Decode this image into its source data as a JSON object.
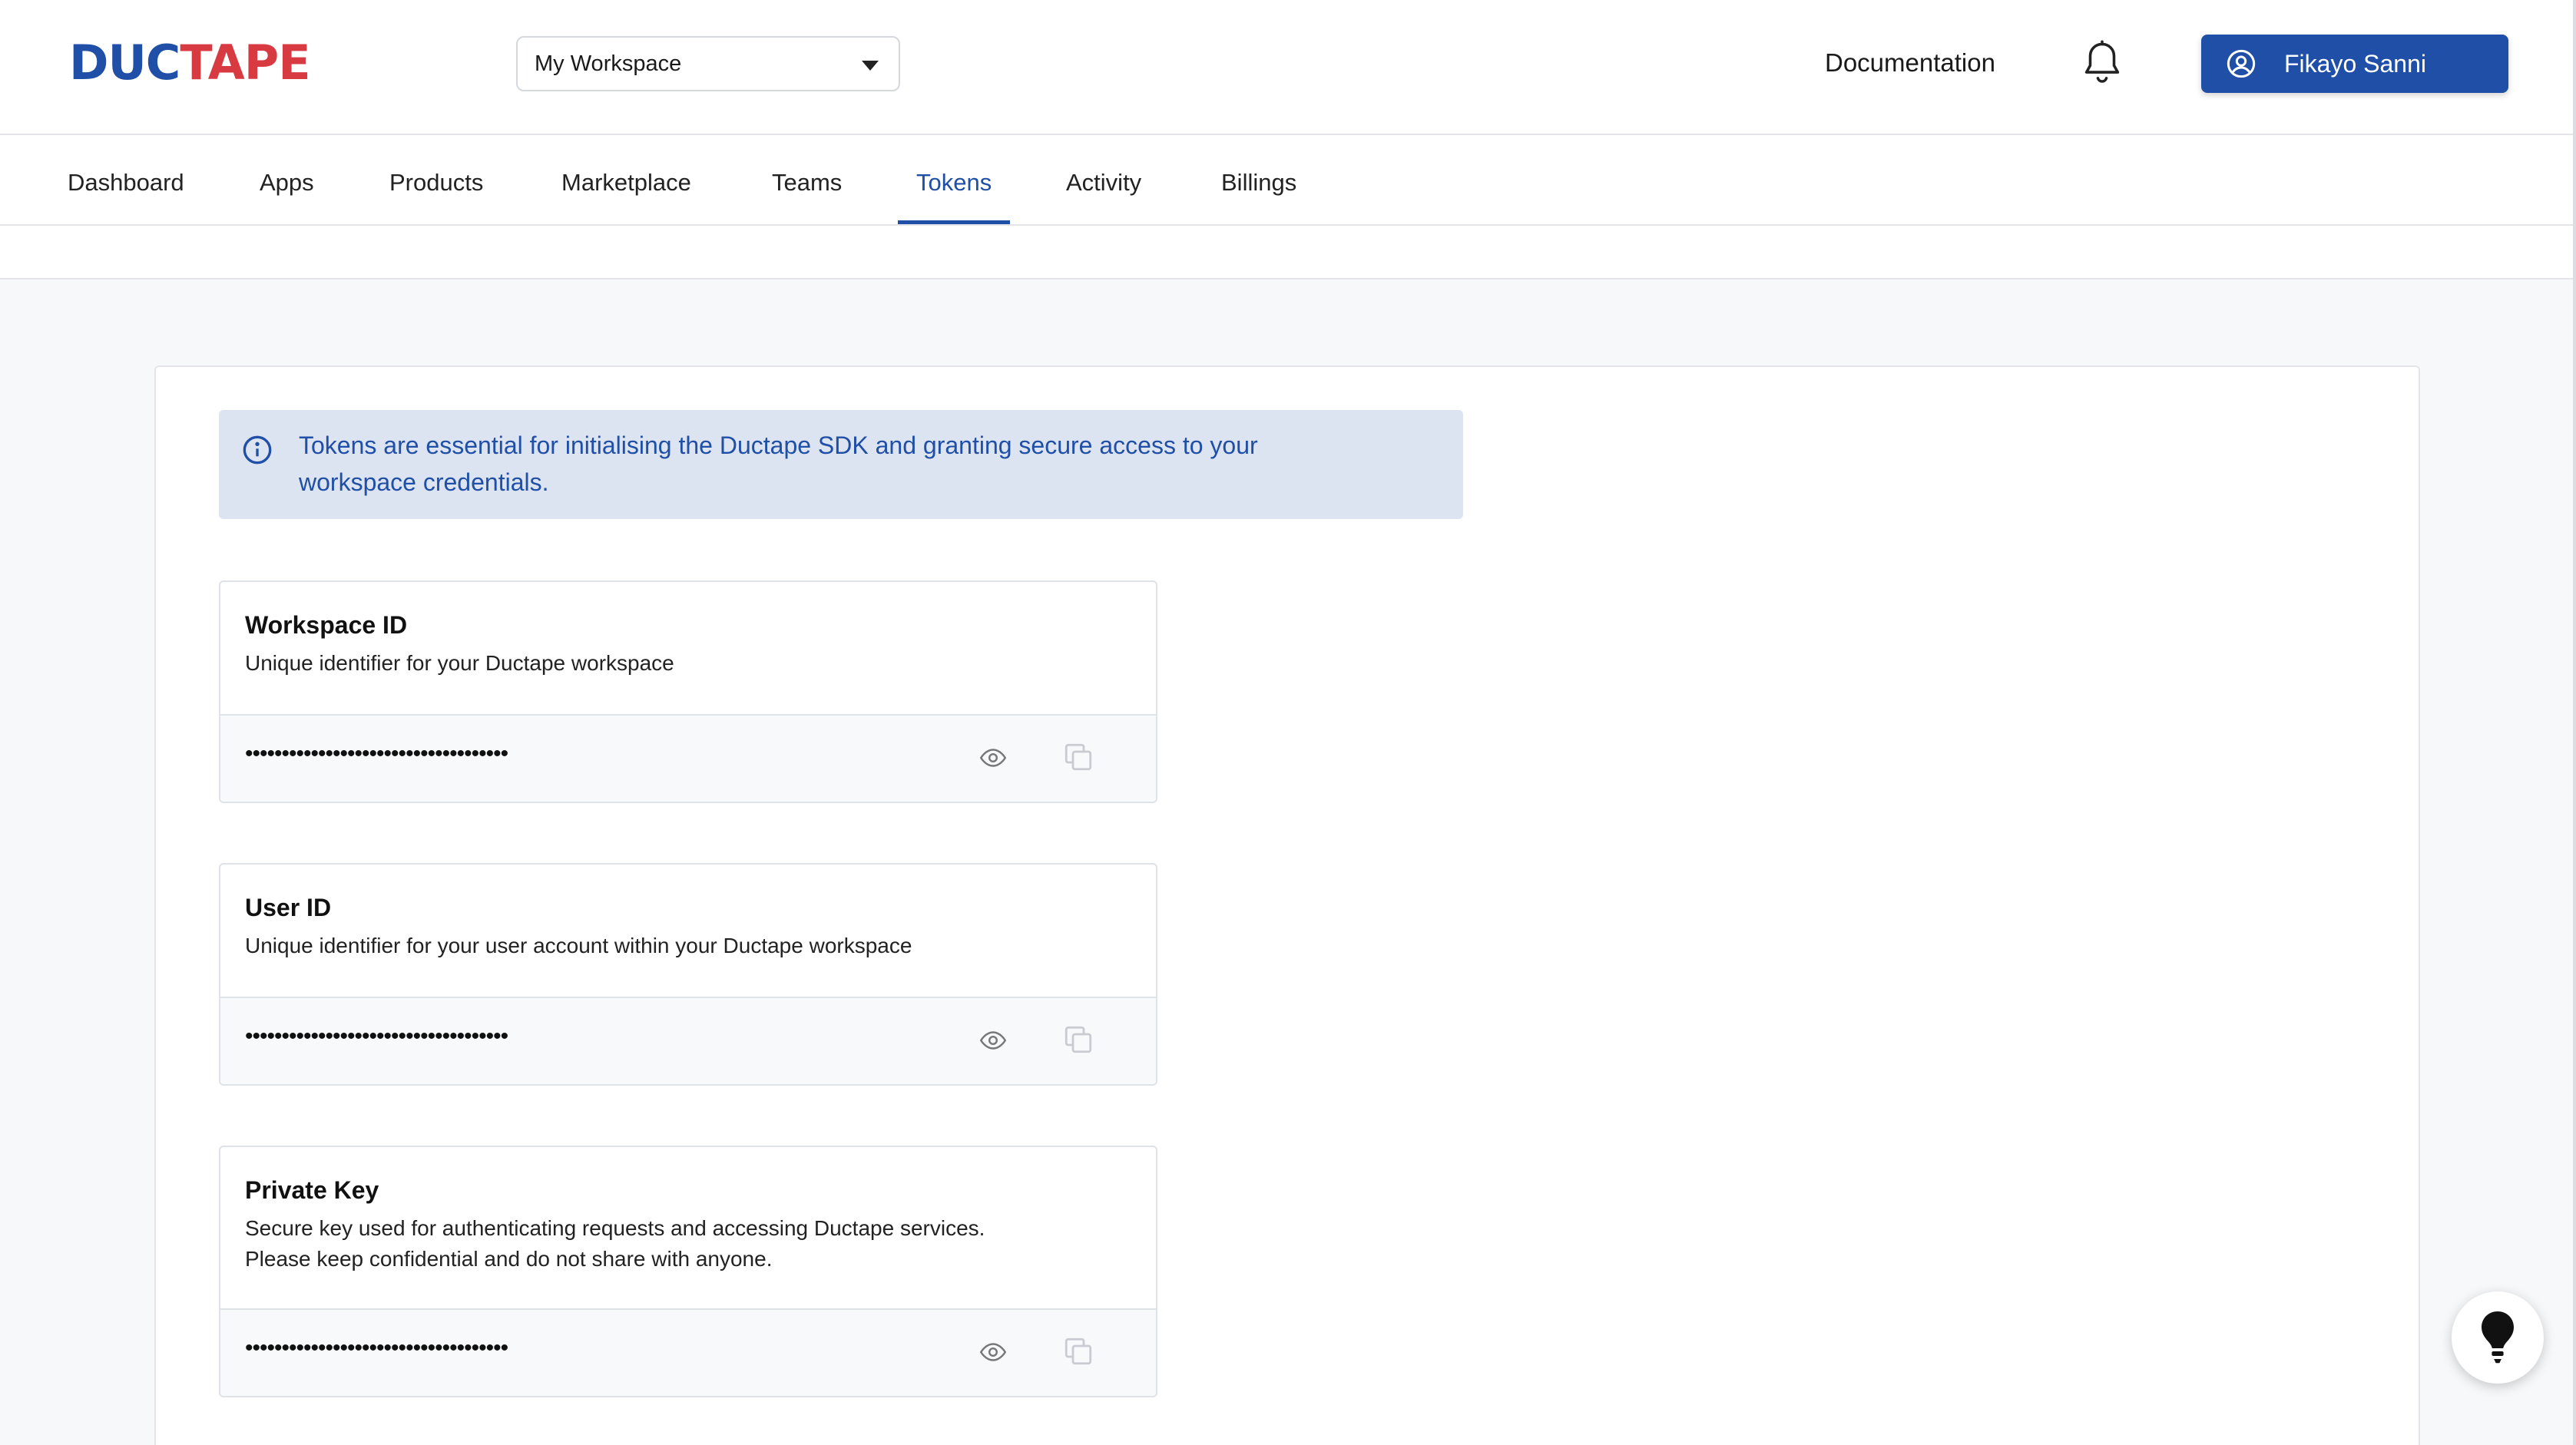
{
  "brand": {
    "part1": "DUC",
    "part2": "TAPE",
    "color1": "#1f4fa6",
    "color2": "#d83a42"
  },
  "workspace_select": {
    "value": "My Workspace"
  },
  "header": {
    "documentation": "Documentation",
    "notification_icon": "bell-icon",
    "user": {
      "name": "Fikayo Sanni",
      "icon": "user-circle-icon"
    }
  },
  "nav": {
    "items": [
      {
        "label": "Dashboard"
      },
      {
        "label": "Apps"
      },
      {
        "label": "Products"
      },
      {
        "label": "Marketplace"
      },
      {
        "label": "Teams"
      },
      {
        "label": "Tokens",
        "active": true
      },
      {
        "label": "Activity"
      },
      {
        "label": "Billings"
      }
    ]
  },
  "info_banner": {
    "icon": "info-icon",
    "text": "Tokens are essential for initialising the Ductape SDK and granting secure access to your workspace credentials."
  },
  "tokens": [
    {
      "title": "Workspace ID",
      "description": "Unique identifier for your Ductape workspace",
      "masked_value": "••••••••••••••••••••••••••••••••••••"
    },
    {
      "title": "User ID",
      "description": "Unique identifier for your user account within your Ductape workspace",
      "masked_value": "••••••••••••••••••••••••••••••••••••"
    },
    {
      "title": "Private Key",
      "description_line1": "Secure key used for authenticating requests and accessing Ductape services.",
      "description_line2": "Please keep confidential and do not share with anyone.",
      "masked_value": "••••••••••••••••••••••••••••••••••••"
    }
  ],
  "icons": {
    "reveal": "eye-icon",
    "copy": "copy-icon",
    "help": "lightbulb-icon"
  },
  "accent_color": "#1f4fa6"
}
